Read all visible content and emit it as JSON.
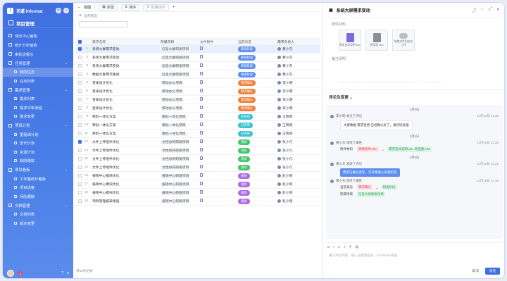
{
  "sidebar": {
    "brand": "讯遁 Informat",
    "project": "项目管理",
    "items": [
      {
        "label": "待办中心面板",
        "type": "item"
      },
      {
        "label": "统计分析面板",
        "type": "item"
      },
      {
        "label": "审批流程台",
        "type": "item"
      },
      {
        "label": "任务管理",
        "type": "group"
      },
      {
        "label": "我的任务",
        "type": "sub",
        "active": true
      },
      {
        "label": "任务列表",
        "type": "sub"
      },
      {
        "label": "需求管理",
        "type": "group"
      },
      {
        "label": "需求列表",
        "type": "sub"
      },
      {
        "label": "需求评审流程",
        "type": "sub"
      },
      {
        "label": "需求变更",
        "type": "sub"
      },
      {
        "label": "项目计划",
        "type": "group"
      },
      {
        "label": "里程碑计划",
        "type": "sub"
      },
      {
        "label": "迭代计划",
        "type": "sub"
      },
      {
        "label": "资源计划",
        "type": "sub"
      },
      {
        "label": "缺陷跟踪",
        "type": "sub"
      },
      {
        "label": "项目看板",
        "type": "group"
      },
      {
        "label": "工作量统计看板",
        "type": "sub"
      },
      {
        "label": "项目进度",
        "type": "sub"
      },
      {
        "label": "风险跟踪",
        "type": "sub"
      },
      {
        "label": "文档管理",
        "type": "group"
      },
      {
        "label": "文档列表",
        "type": "sub"
      },
      {
        "label": "版本变更",
        "type": "sub"
      }
    ],
    "notif_count": "2"
  },
  "toolbar": {
    "view_label": "视图",
    "new_label": "新建",
    "sort_label": "排序",
    "batch_label": "批量操作"
  },
  "filter": {
    "label": "全部筛选"
  },
  "table": {
    "headers": [
      "需求名称",
      "所属项目",
      "文件附件",
      "当前状态",
      "需求负责人"
    ],
    "rows": [
      {
        "name": "系统大屏需求变动",
        "proj": "信息大屏研发项目",
        "status": "研发阶段",
        "color": "#5c8ff0",
        "owner": "黄小东",
        "hl": true,
        "checked": true
      },
      {
        "name": "系统大屏需求变动",
        "proj": "信息大屏研发项目",
        "status": "研发阶段",
        "color": "#5c8ff0",
        "owner": "黄小东"
      },
      {
        "name": "系统大屏需求变动",
        "proj": "信息大屏研发项目",
        "status": "研发阶段",
        "color": "#5c8ff0",
        "owner": "黄小东"
      },
      {
        "name": "数据大屏需求跟进",
        "proj": "信息大屏研发项目",
        "status": "研发阶段",
        "color": "#5c8ff0",
        "owner": "黄小东"
      },
      {
        "name": "登录设计优化",
        "proj": "移动办公项目",
        "status": "需求确认",
        "color": "#f0813c",
        "owner": "李小明"
      },
      {
        "name": "登录设计优化",
        "proj": "移动办公项目",
        "status": "需求确认",
        "color": "#f0813c",
        "owner": "李小明"
      },
      {
        "name": "登录设计优化",
        "proj": "移动办公项目",
        "status": "需求确认",
        "color": "#f0813c",
        "owner": "李小明"
      },
      {
        "name": "登录设计优化",
        "proj": "移动办公项目",
        "status": "需求确认",
        "color": "#f0813c",
        "owner": "李小明"
      },
      {
        "name": "审批一体化方案",
        "proj": "审批一体化项目",
        "status": "待评审",
        "color": "#3cc3d6",
        "owner": "王晓晓"
      },
      {
        "name": "审批一体化方案",
        "proj": "审批一体化项目",
        "status": "已评审",
        "color": "#3cc3d6",
        "owner": "王晓晓"
      },
      {
        "name": "审批一体化方案",
        "proj": "审批一体化项目",
        "status": "已评审",
        "color": "#3cc3d6",
        "owner": "王晓晓"
      },
      {
        "name": "文件上传组件优化",
        "proj": "文档协同研发项目",
        "status": "测试",
        "color": "#46c46e",
        "owner": "张小凡",
        "checked": true
      },
      {
        "name": "文件上传组件优化",
        "proj": "文档协同研发项目",
        "status": "测试",
        "color": "#46c46e",
        "owner": "张小凡"
      },
      {
        "name": "文件上传组件优化",
        "proj": "文档协同研发项目",
        "status": "测试",
        "color": "#46c46e",
        "owner": "张小凡"
      },
      {
        "name": "文件上传组件优化",
        "proj": "文档协同研发项目",
        "status": "测试",
        "color": "#46c46e",
        "owner": "张小凡"
      },
      {
        "name": "报销中心模块优化",
        "proj": "报销中心研发项目",
        "status": "规划",
        "color": "#b069e0",
        "owner": "赵小刚"
      },
      {
        "name": "报销中心模块优化",
        "proj": "报销中心研发项目",
        "status": "规划",
        "color": "#b069e0",
        "owner": "赵小刚"
      },
      {
        "name": "报销中心模块优化",
        "proj": "报销中心研发项目",
        "status": "规划",
        "color": "#b069e0",
        "owner": "赵小刚"
      },
      {
        "name": "项目管理报表增强",
        "proj": "报销中心研发项目",
        "status": "规划",
        "color": "#b069e0",
        "owner": "赵小刚"
      }
    ],
    "footer": "共19条记录"
  },
  "panel": {
    "title": "系统大屏需求变动",
    "attach_label": "附件材料",
    "attachments": [
      {
        "name": "需求变动说明.doc",
        "kind": "doc"
      },
      {
        "name": "原型图.xlsx",
        "kind": "gray"
      },
      {
        "name": "拖拽文件到此处上传",
        "kind": "cloud"
      }
    ],
    "remark_label": "备注说明",
    "feed_title": "评论及变更",
    "feed": [
      {
        "date": "3月5日"
      },
      {
        "user": "李小明 关注了评论",
        "time": "12月16日 11:35"
      },
      {
        "bubble": "大屏数据 需求变更 已经确认好了，请尽快处理"
      },
      {
        "date": "3月5日"
      },
      {
        "user": "黄小东 修改了属性",
        "time": "12月16日 11:35"
      },
      {
        "kv": {
          "k": "附件材料",
          "old": "原始附件.doc",
          "new": "需求变动说明.doc 原型图.xlsx"
        }
      },
      {
        "date": "3月5日"
      },
      {
        "user": "黄小东 发表了评论",
        "time": "12月16日 11:35"
      },
      {
        "bubble_blue": "需求已确认完毕，可开始进入研发阶段"
      },
      {
        "user": "黄小东 修改了属性",
        "time": "12月16日 11:35"
      },
      {
        "kv": {
          "k": "当前状态",
          "old": "需求确认",
          "new": "研发阶段"
        }
      },
      {
        "kv": {
          "k": "所属项目",
          "old": "",
          "new": "信息大屏研发项目"
        }
      }
    ],
    "editor_placeholder": "输入评论内容，输入@提到成员，Ctrl+Enter发送",
    "cancel": "取消",
    "send": "发送"
  },
  "colors": {
    "brand": "#3f6fe0",
    "active_row": "#e8f0ff"
  }
}
